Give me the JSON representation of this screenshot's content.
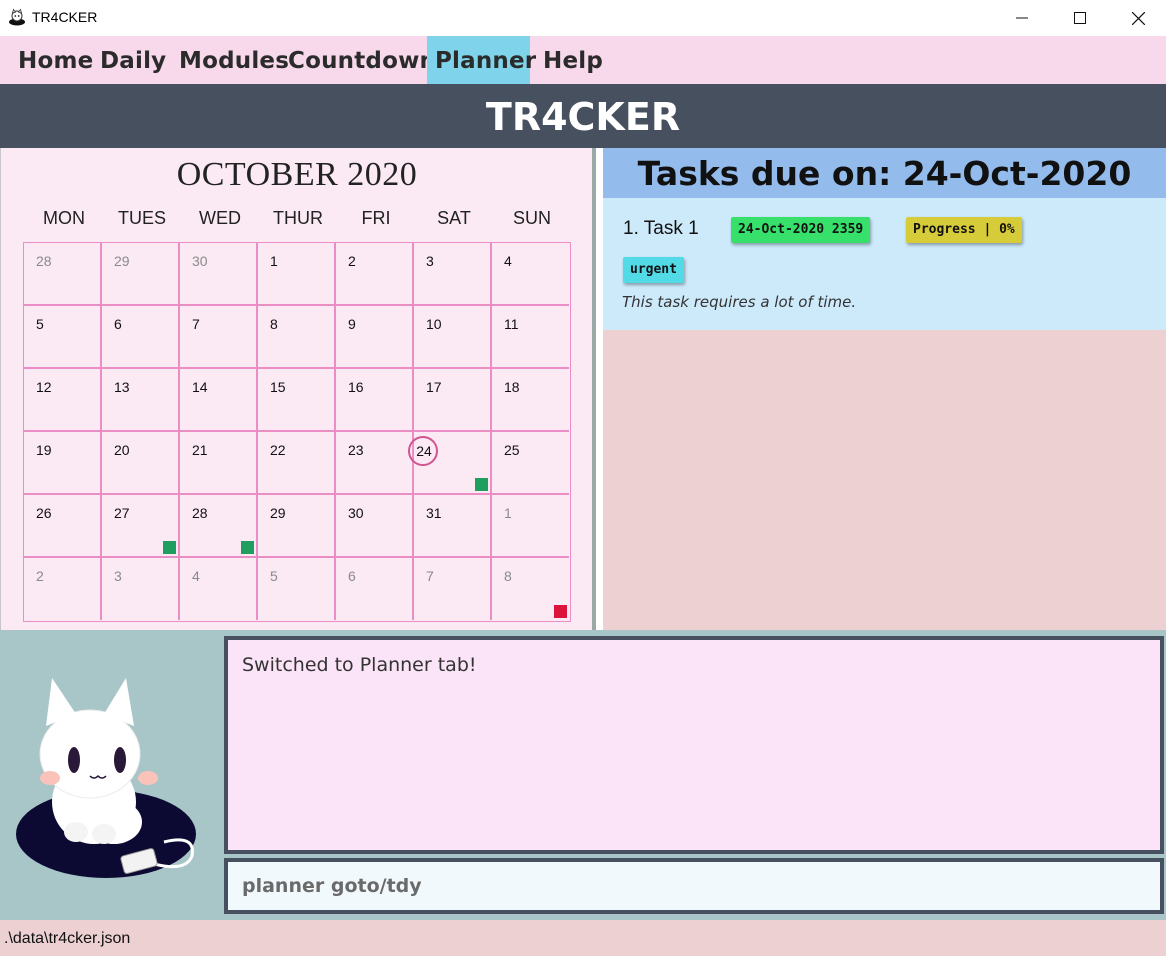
{
  "window": {
    "title": "TR4CKER"
  },
  "menu": {
    "items": [
      {
        "label": "Home",
        "active": false
      },
      {
        "label": "Daily",
        "active": false
      },
      {
        "label": "Modules",
        "active": false
      },
      {
        "label": "Countdowns",
        "active": false
      },
      {
        "label": "Planner",
        "active": true
      },
      {
        "label": "Help",
        "active": false
      }
    ]
  },
  "header": {
    "title": "TR4CKER"
  },
  "calendar": {
    "month_title": "OCTOBER 2020",
    "days_of_week": [
      "MON",
      "TUES",
      "WED",
      "THUR",
      "FRI",
      "SAT",
      "SUN"
    ],
    "weeks": [
      [
        {
          "d": "28",
          "cur": false
        },
        {
          "d": "29",
          "cur": false
        },
        {
          "d": "30",
          "cur": false
        },
        {
          "d": "1",
          "cur": true
        },
        {
          "d": "2",
          "cur": true
        },
        {
          "d": "3",
          "cur": true
        },
        {
          "d": "4",
          "cur": true
        }
      ],
      [
        {
          "d": "5",
          "cur": true
        },
        {
          "d": "6",
          "cur": true
        },
        {
          "d": "7",
          "cur": true
        },
        {
          "d": "8",
          "cur": true
        },
        {
          "d": "9",
          "cur": true
        },
        {
          "d": "10",
          "cur": true
        },
        {
          "d": "11",
          "cur": true
        }
      ],
      [
        {
          "d": "12",
          "cur": true
        },
        {
          "d": "13",
          "cur": true
        },
        {
          "d": "14",
          "cur": true
        },
        {
          "d": "15",
          "cur": true
        },
        {
          "d": "16",
          "cur": true
        },
        {
          "d": "17",
          "cur": true
        },
        {
          "d": "18",
          "cur": true
        }
      ],
      [
        {
          "d": "19",
          "cur": true
        },
        {
          "d": "20",
          "cur": true
        },
        {
          "d": "21",
          "cur": true
        },
        {
          "d": "22",
          "cur": true
        },
        {
          "d": "23",
          "cur": true
        },
        {
          "d": "24",
          "cur": true,
          "today": true,
          "marker": "green"
        },
        {
          "d": "25",
          "cur": true
        }
      ],
      [
        {
          "d": "26",
          "cur": true
        },
        {
          "d": "27",
          "cur": true,
          "marker": "green"
        },
        {
          "d": "28",
          "cur": true,
          "marker": "green"
        },
        {
          "d": "29",
          "cur": true
        },
        {
          "d": "30",
          "cur": true
        },
        {
          "d": "31",
          "cur": true
        },
        {
          "d": "1",
          "cur": false
        }
      ],
      [
        {
          "d": "2",
          "cur": false
        },
        {
          "d": "3",
          "cur": false
        },
        {
          "d": "4",
          "cur": false
        },
        {
          "d": "5",
          "cur": false
        },
        {
          "d": "6",
          "cur": false
        },
        {
          "d": "7",
          "cur": false
        },
        {
          "d": "8",
          "cur": false,
          "marker": "red"
        }
      ]
    ],
    "colors": {
      "marker_green": "#1f9e5f",
      "marker_red": "#dc143c",
      "grid": "#ec8ec6",
      "today_ring": "#d1558e"
    }
  },
  "tasks_panel": {
    "header": "Tasks due on: 24-Oct-2020",
    "tasks": [
      {
        "title": "1.  Task 1",
        "deadline_tag": "24-Oct-2020 2359",
        "progress_tag": "Progress | 0%",
        "tag": "urgent",
        "description": "This task requires a lot of time."
      }
    ]
  },
  "result_display": {
    "text": "Switched to Planner tab!"
  },
  "command_box": {
    "value": "planner goto/tdy"
  },
  "status_bar": {
    "path": ".\\data\\tr4cker.json"
  }
}
